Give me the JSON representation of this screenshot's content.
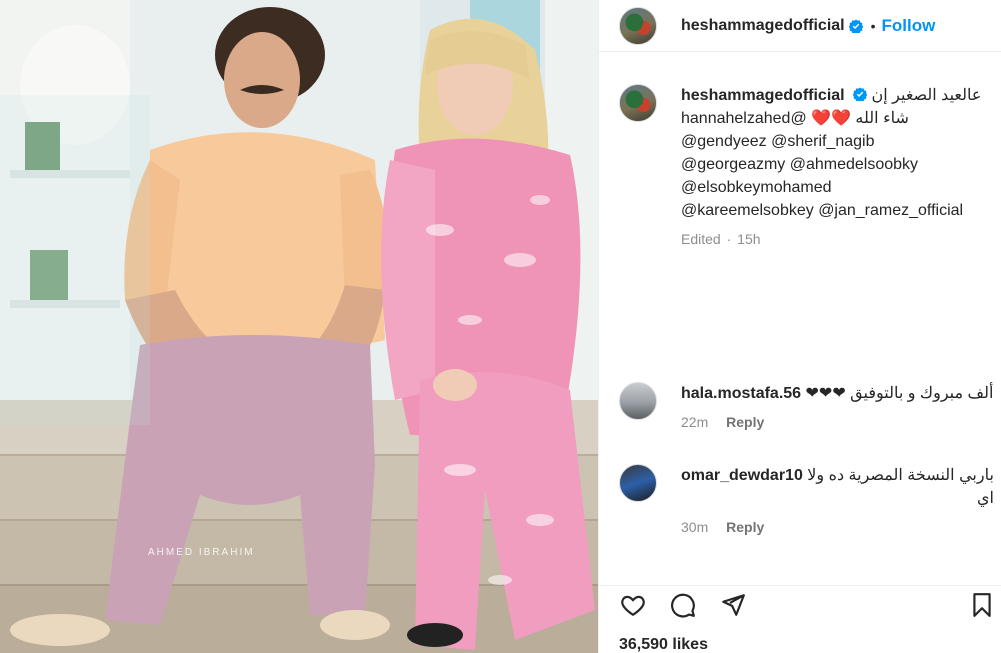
{
  "photo": {
    "watermark": "AHMED IBRAHIM"
  },
  "header": {
    "username": "heshammagedofficial",
    "separator": "•",
    "follow_label": "Follow"
  },
  "caption": {
    "username": "heshammagedofficial",
    "line1_text": "عالعيد الصغير إن",
    "line2_text": "hannahelzahed@ ❤️❤️ شاء الله",
    "line3": "@gendyeez @sherif_nagib",
    "line4": "@georgeazmy @ahmedelsoobky",
    "line5": "@elsobkeymohamed",
    "line6": "@kareemelsobkey @jan_ramez_official",
    "edited": "Edited",
    "sep": "·",
    "time": "15h"
  },
  "comments": [
    {
      "username": "hala.mostafa.56",
      "text": "ألف مبروك و بالتوفيق ❤❤❤",
      "time": "22m",
      "reply": "Reply"
    },
    {
      "username": "omar_dewdar10",
      "text": "باربي النسخة المصرية ده ولا",
      "text2": "اي",
      "time": "30m",
      "reply": "Reply"
    }
  ],
  "likes": "36,590 likes",
  "icons": [
    "heart-icon",
    "comment-icon",
    "share-icon",
    "bookmark-icon",
    "verified-icon"
  ],
  "colors": {
    "accent": "#0095f6",
    "text": "#262626",
    "muted": "#8e8e8e"
  }
}
